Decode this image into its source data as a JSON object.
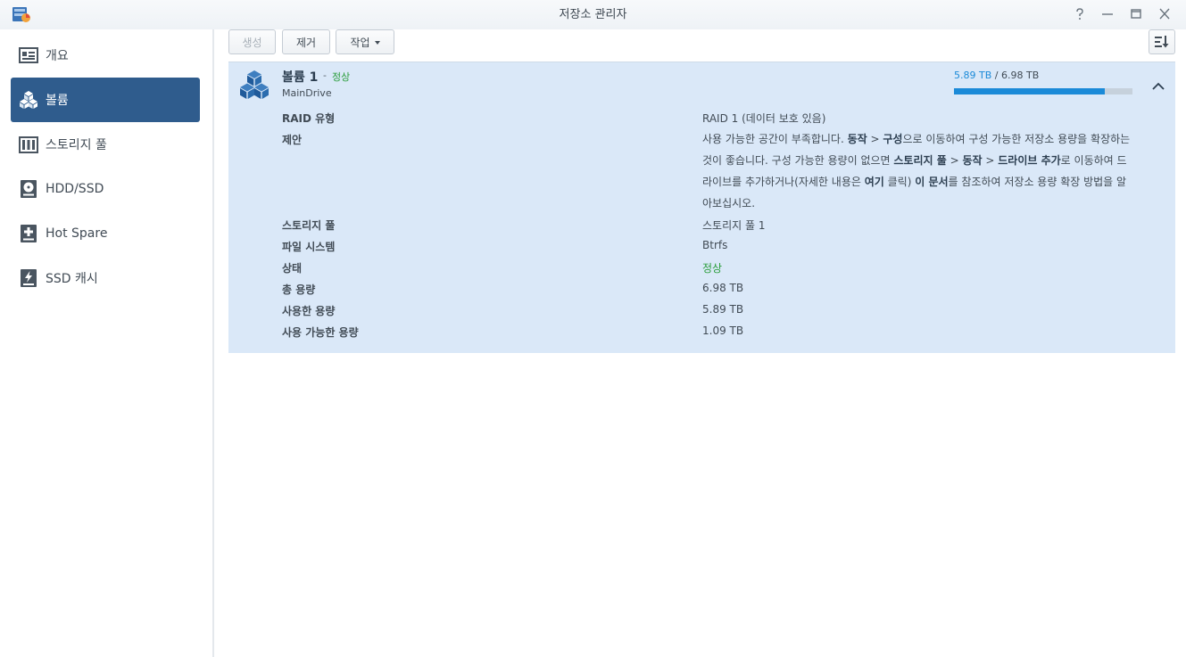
{
  "window": {
    "title": "저장소 관리자",
    "controls": [
      "help-icon",
      "minimize-icon",
      "maximize-icon",
      "close-icon"
    ]
  },
  "sidebar": {
    "items": [
      {
        "label": "개요",
        "icon": "overview-icon",
        "active": false
      },
      {
        "label": "볼륨",
        "icon": "volume-icon",
        "active": true
      },
      {
        "label": "스토리지 풀",
        "icon": "storage-pool-icon",
        "active": false
      },
      {
        "label": "HDD/SSD",
        "icon": "hdd-icon",
        "active": false
      },
      {
        "label": "Hot Spare",
        "icon": "hot-spare-icon",
        "active": false
      },
      {
        "label": "SSD 캐시",
        "icon": "ssd-cache-icon",
        "active": false
      }
    ],
    "active_color": "#2f5c8d"
  },
  "toolbar": {
    "create_label": "생성",
    "remove_label": "제거",
    "action_label": "작업"
  },
  "volume": {
    "name": "볼륨 1",
    "separator": "-",
    "status": "정상",
    "description": "MainDrive",
    "used": "5.89 TB",
    "usage_separator": "/",
    "total": "6.98 TB",
    "usage_fraction": 0.844,
    "status_color": "#2a9d3b",
    "properties": {
      "raid_label": "RAID 유형",
      "raid_value": "RAID 1 (데이터 보호 있음)",
      "suggest_label": "제안",
      "suggest": {
        "t1": "사용 가능한 공간이 부족합니다. ",
        "b1": "동작",
        "t2": " > ",
        "b2": "구성",
        "t3": "으로 이동하여 구성 가능한 저장소 용량을 확장하는 것이 좋습니다. 구성 가능한 용량이 없으면 ",
        "b3": "스토리지 풀",
        "t4": " > ",
        "b4": "동작",
        "t5": " > ",
        "b5": "드라이브 추가",
        "t6": "로 이동하여 드라이브를 추가하거나(자세한 내용은 ",
        "b6": "여기",
        "t7": " 클릭) ",
        "b7": "이 문서",
        "t8": "를 참조하여 저장소 용량 확장 방법을 알아보십시오."
      },
      "pool_label": "스토리지 풀",
      "pool_value": "스토리지 풀 1",
      "fs_label": "파일 시스템",
      "fs_value": "Btrfs",
      "status_label": "상태",
      "status_value": "정상",
      "total_label": "총 용량",
      "total_value": "6.98 TB",
      "used_label": "사용한 용량",
      "used_value": "5.89 TB",
      "free_label": "사용 가능한 용량",
      "free_value": "1.09 TB"
    }
  }
}
